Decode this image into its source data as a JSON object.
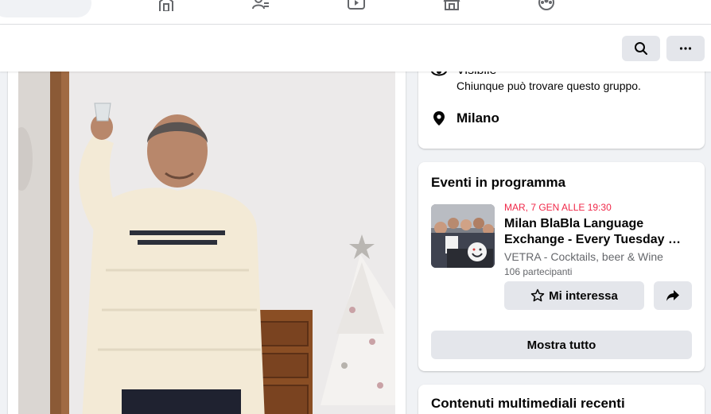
{
  "topnav": {
    "icons": [
      "home-icon",
      "friends-icon",
      "video-icon",
      "marketplace-icon",
      "groups-icon"
    ]
  },
  "header": {
    "search_icon": "search-icon",
    "more_icon": "more-icon"
  },
  "about": {
    "visibility_title": "Visibile",
    "visibility_desc": "Chiunque può trovare questo gruppo.",
    "location": "Milano"
  },
  "events": {
    "title": "Eventi in programma",
    "items": [
      {
        "date": "MAR, 7 GEN ALLE 19:30",
        "name_line1": "Milan BlaBla Language",
        "name_line2": "Exchange - Every Tuesday …",
        "venue": "VETRA - Cocktails, beer & Wine",
        "participants": "106 partecipanti",
        "interest_label": "Mi interessa"
      }
    ],
    "show_all_label": "Mostra tutto"
  },
  "media": {
    "title": "Contenuti multimediali recenti"
  },
  "colors": {
    "accent_date": "#f02849",
    "button_bg": "#e4e6eb",
    "page_bg": "#f0f2f5"
  }
}
